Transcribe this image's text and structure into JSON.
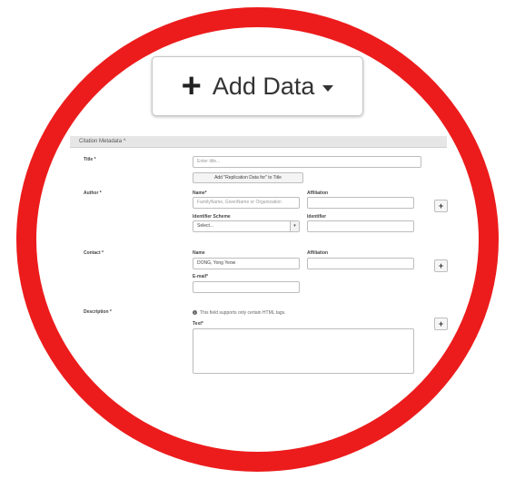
{
  "add_data": {
    "label": "Add Data",
    "icon": "plus-icon"
  },
  "citation_metadata": {
    "header": "Citation Metadata ^",
    "title": {
      "label": "Title *",
      "placeholder": "Enter title...",
      "replication_button": "Add \"Replication Data for\" to Title"
    },
    "author": {
      "label": "Author *",
      "name_label": "Name*",
      "name_placeholder": "FamilyName, GivenName or Organization",
      "affiliation_label": "Affiliation",
      "identifier_scheme_label": "Identifier Scheme",
      "identifier_scheme_value": "Select...",
      "identifier_label": "Identifier"
    },
    "contact": {
      "label": "Contact *",
      "name_label": "Name",
      "name_value": "DONG, Yong Yeow",
      "affiliation_label": "Affiliation",
      "email_label": "E-mail*"
    },
    "description": {
      "label": "Description *",
      "help_text": "This field supports only certain HTML tags.",
      "text_label": "Text*"
    }
  },
  "colors": {
    "highlight_ring": "#ec1c1c"
  }
}
